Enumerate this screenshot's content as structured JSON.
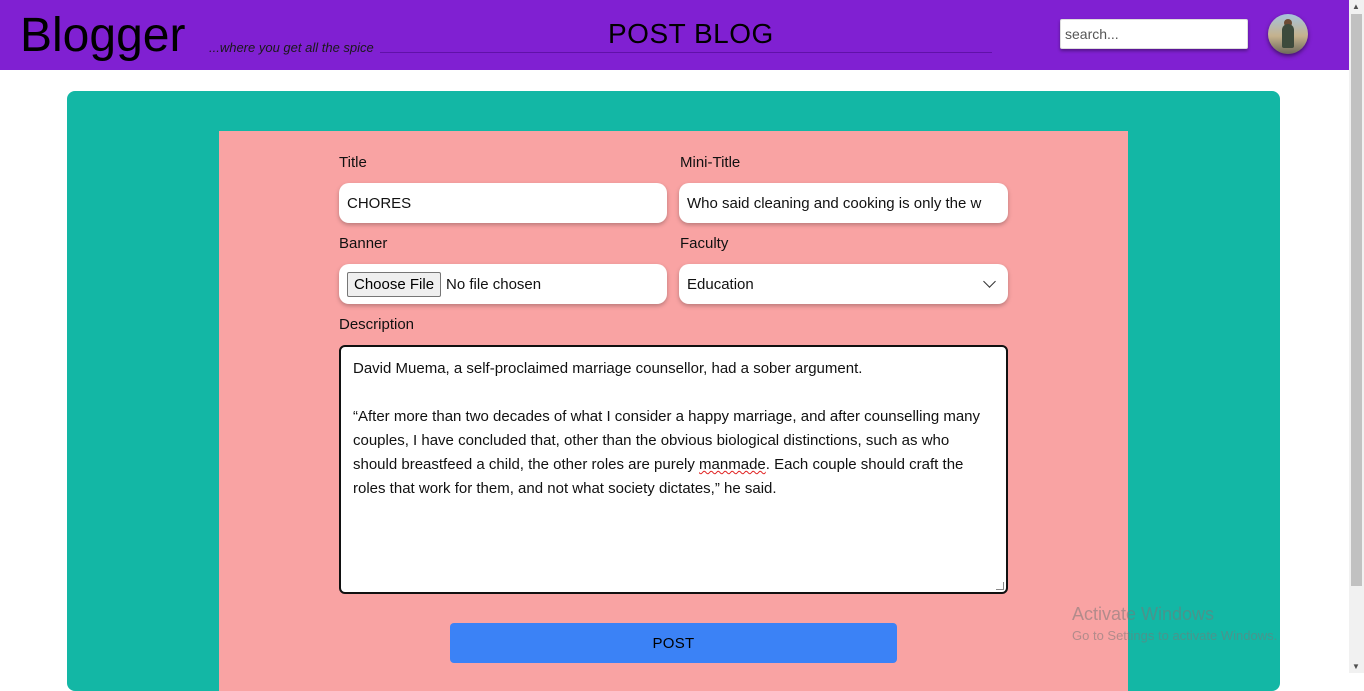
{
  "header": {
    "brand": "Blogger",
    "tagline": "...where you get all the spice",
    "page_title": "POST BLOG",
    "search_placeholder": "search...",
    "accent_color": "#8020d2"
  },
  "form": {
    "title_label": "Title",
    "title_value": "CHORES",
    "mini_title_label": "Mini-Title",
    "mini_title_value": "Who said cleaning and cooking is only the w",
    "banner_label": "Banner",
    "banner_button": "Choose File",
    "banner_status": "No file chosen",
    "faculty_label": "Faculty",
    "faculty_value": "Education",
    "description_label": "Description",
    "description_p1": "David Muema, a self-proclaimed marriage counsellor, had a sober argument.",
    "description_p2_a": "“After more than two decades of what I consider a happy marriage, and after counselling many couples, I have concluded that, other than the obvious biological distinctions, such as who should breastfeed a child, the other roles are purely ",
    "description_p2_misspelled": "manmade",
    "description_p2_b": ". Each couple should craft the roles that work for them, and not what society dictates,” he said.",
    "post_button": "POST"
  },
  "colors": {
    "card": "#13b7a5",
    "panel": "#f9a3a3",
    "button": "#3b82f6"
  },
  "watermark": {
    "title": "Activate Windows",
    "subtitle": "Go to Settings to activate Windows."
  },
  "icons": {
    "faculty_dropdown": "chevron-down-icon"
  }
}
